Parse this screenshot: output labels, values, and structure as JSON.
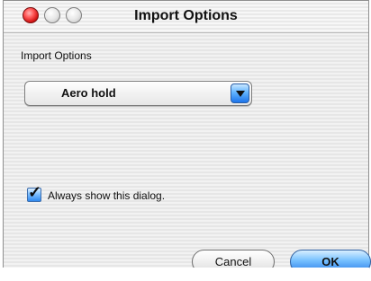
{
  "window": {
    "title": "Import Options"
  },
  "dialog": {
    "section_label": "Import Options",
    "popup_value": "Aero hold",
    "checkbox_label": "Always show this dialog.",
    "checkbox_checked": true,
    "cancel_label": "Cancel",
    "ok_label": "OK"
  },
  "colors": {
    "accent_blue": "#4ea7ff",
    "close_red": "#d21414"
  },
  "icons": {
    "close": "close-icon",
    "minimize": "minimize-icon",
    "zoom": "zoom-icon",
    "popup": "chevron-down-icon",
    "checkbox": "checkmark-icon"
  }
}
